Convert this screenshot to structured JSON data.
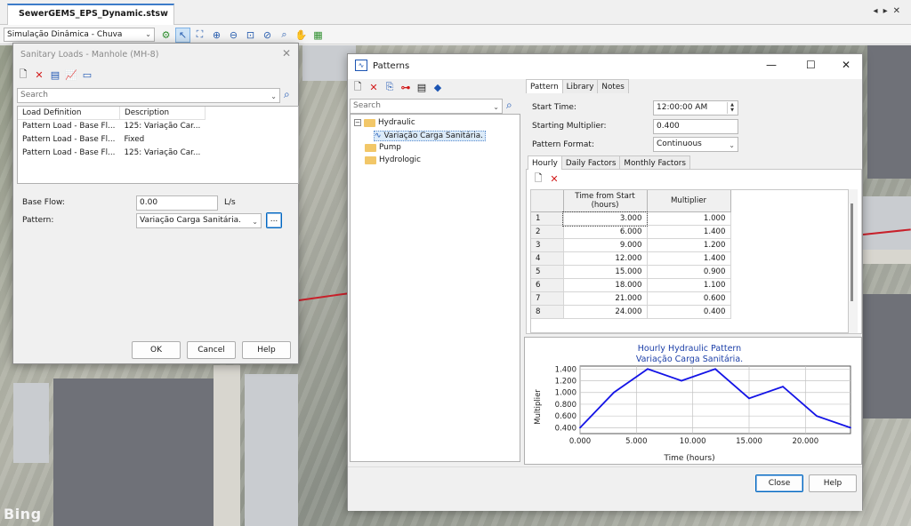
{
  "document_tab": {
    "title": "SewerGEMS_EPS_Dynamic.stsw"
  },
  "toolbar": {
    "scenario": "Simulação Dinâmica - Chuva"
  },
  "map": {
    "watermark": "Bing"
  },
  "sanitary_dialog": {
    "title": "Sanitary Loads - Manhole (MH-8)",
    "search_placeholder": "Search",
    "columns": [
      "Load Definition",
      "Description"
    ],
    "rows": [
      {
        "load_definition": "Pattern Load - Base Fl...",
        "description": "125:  Variação Car..."
      },
      {
        "load_definition": "Pattern Load - Base Fl...",
        "description": "Fixed"
      },
      {
        "load_definition": "Pattern Load - Base Fl...",
        "description": "125:  Variação Car..."
      }
    ],
    "base_flow_label": "Base Flow:",
    "base_flow_value": "0.00",
    "base_flow_unit": "L/s",
    "pattern_label": "Pattern:",
    "pattern_value": "Variação Carga Sanitária.",
    "ellipsis_label": "...",
    "ok_label": "OK",
    "cancel_label": "Cancel",
    "help_label": "Help"
  },
  "patterns_dialog": {
    "title": "Patterns",
    "search_placeholder": "Search",
    "tree": {
      "hydraulic": "Hydraulic",
      "pattern_item": "Variação Carga Sanitária.",
      "pump": "Pump",
      "hydrologic": "Hydrologic"
    },
    "tabs": [
      "Pattern",
      "Library",
      "Notes"
    ],
    "start_time_label": "Start Time:",
    "start_time_value": "12:00:00 AM",
    "starting_multiplier_label": "Starting Multiplier:",
    "starting_multiplier_value": "0.400",
    "pattern_format_label": "Pattern Format:",
    "pattern_format_value": "Continuous",
    "sub_tabs": [
      "Hourly",
      "Daily Factors",
      "Monthly Factors"
    ],
    "table_columns": [
      "Time from Start (hours)",
      "Multiplier"
    ],
    "table_rows": [
      {
        "n": "1",
        "time": "3.000",
        "mult": "1.000"
      },
      {
        "n": "2",
        "time": "6.000",
        "mult": "1.400"
      },
      {
        "n": "3",
        "time": "9.000",
        "mult": "1.200"
      },
      {
        "n": "4",
        "time": "12.000",
        "mult": "1.400"
      },
      {
        "n": "5",
        "time": "15.000",
        "mult": "0.900"
      },
      {
        "n": "6",
        "time": "18.000",
        "mult": "1.100"
      },
      {
        "n": "7",
        "time": "21.000",
        "mult": "0.600"
      },
      {
        "n": "8",
        "time": "24.000",
        "mult": "0.400"
      }
    ],
    "close_label": "Close",
    "help_label": "Help"
  },
  "chart_data": {
    "type": "line",
    "title": "Hourly Hydraulic Pattern",
    "subtitle": "Variação Carga Sanitária.",
    "xlabel": "Time (hours)",
    "ylabel": "Multiplier",
    "x": [
      0,
      3,
      6,
      9,
      12,
      15,
      18,
      21,
      24
    ],
    "series": [
      {
        "values": [
          0.4,
          1.0,
          1.4,
          1.2,
          1.4,
          0.9,
          1.1,
          0.6,
          0.4
        ],
        "color": "#1414e6"
      }
    ],
    "xlim": [
      0,
      24
    ],
    "ylim": [
      0.3,
      1.45
    ],
    "xticks": [
      0,
      5,
      10,
      15,
      20
    ],
    "xtick_labels": [
      "0.000",
      "5.000",
      "10.000",
      "15.000",
      "20.000"
    ],
    "yticks": [
      0.4,
      0.6,
      0.8,
      1.0,
      1.2,
      1.4
    ],
    "ytick_labels": [
      "0.400",
      "0.600",
      "0.800",
      "1.000",
      "1.200",
      "1.400"
    ],
    "grid": true,
    "title_color": "#1c3fa8"
  }
}
